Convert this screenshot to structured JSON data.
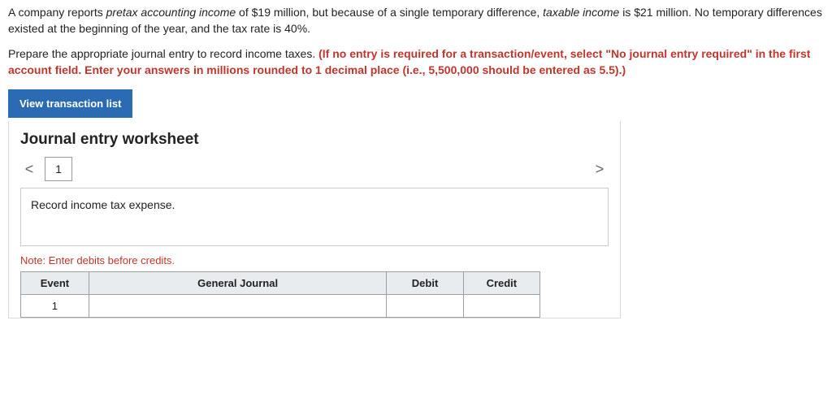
{
  "intro": {
    "p1a": "A company reports ",
    "em1": "pretax accounting income",
    "p1b": " of $19 million, but because of a single temporary difference, ",
    "em2": "taxable income",
    "p1c": " is $21 million. No temporary differences existed at the beginning of the year, and the tax rate is 40%."
  },
  "instr": {
    "lead": "Prepare the appropriate journal entry to record income taxes. ",
    "bold": "(If no entry is required for a transaction/event, select \"No journal entry required\" in the first account field. Enter your answers in millions rounded to 1 decimal place (i.e., 5,500,000 should be entered as 5.5).)"
  },
  "buttons": {
    "view_list": "View transaction list"
  },
  "worksheet": {
    "title": "Journal entry worksheet",
    "prev": "<",
    "next": ">",
    "tab1": "1",
    "description": "Record income tax expense.",
    "note": "Note: Enter debits before credits.",
    "headers": {
      "event": "Event",
      "gj": "General Journal",
      "debit": "Debit",
      "credit": "Credit"
    },
    "rows": [
      {
        "event": "1",
        "gj": "",
        "debit": "",
        "credit": ""
      }
    ]
  }
}
